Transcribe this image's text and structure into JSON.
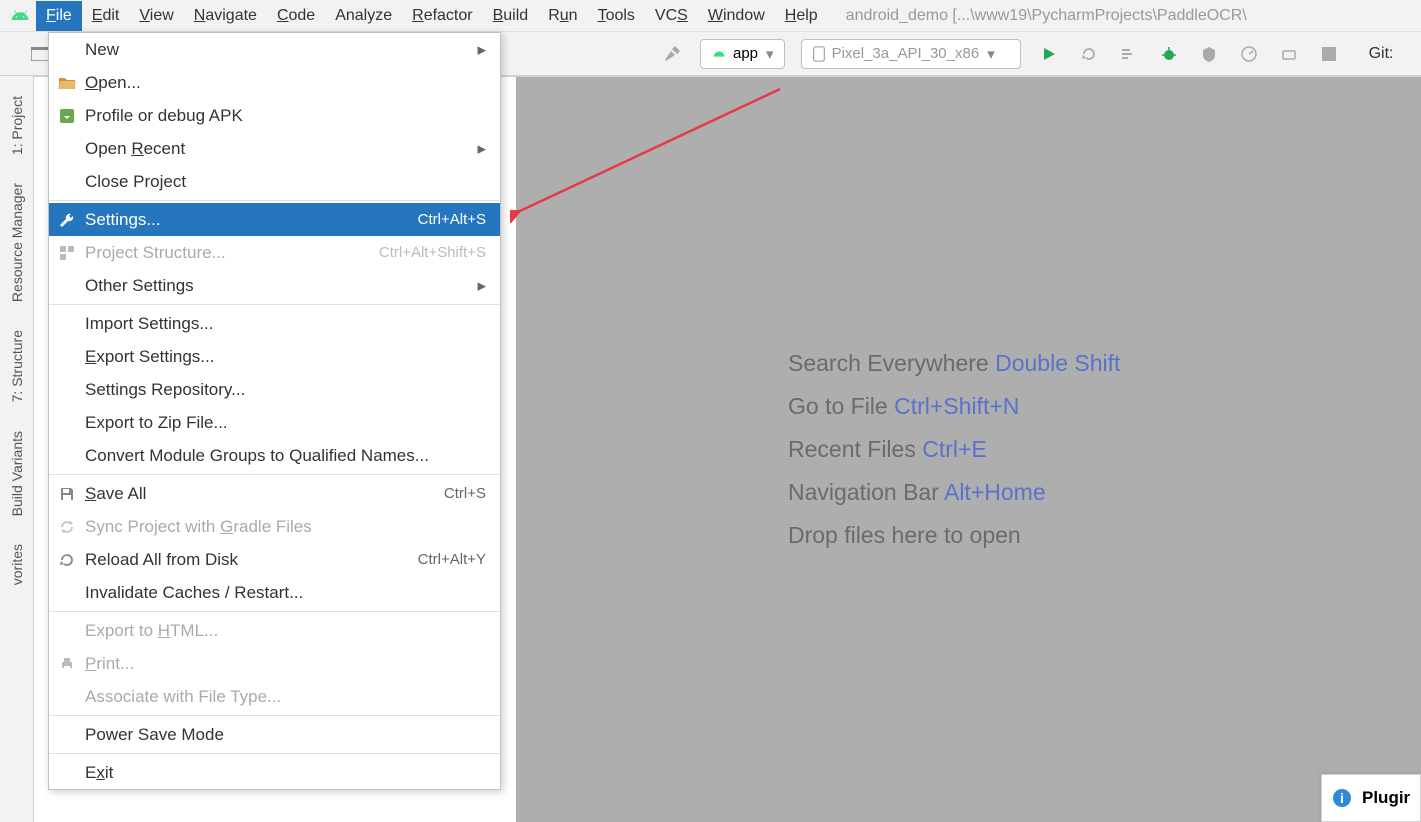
{
  "menubar": {
    "items": [
      {
        "label": "File",
        "underline": "F",
        "active": true
      },
      {
        "label": "Edit",
        "underline": "E"
      },
      {
        "label": "View",
        "underline": "V"
      },
      {
        "label": "Navigate",
        "underline": "N"
      },
      {
        "label": "Code",
        "underline": "C"
      },
      {
        "label": "Analyze"
      },
      {
        "label": "Refactor",
        "underline": "R"
      },
      {
        "label": "Build",
        "underline": "B"
      },
      {
        "label": "Run",
        "underline": "u"
      },
      {
        "label": "Tools",
        "underline": "T"
      },
      {
        "label": "VCS",
        "underline": "S"
      },
      {
        "label": "Window",
        "underline": "W"
      },
      {
        "label": "Help",
        "underline": "H"
      }
    ],
    "project_title": "android_demo [...\\www19\\PycharmProjects\\PaddleOCR\\"
  },
  "toolbar": {
    "app_selector": "app",
    "device_selector": "Pixel_3a_API_30_x86",
    "git_label": "Git:"
  },
  "tool_strip": {
    "items": [
      {
        "label": "1: Project",
        "icon": "folder-icon"
      },
      {
        "label": "Resource Manager",
        "icon": "resource-icon"
      },
      {
        "label": "7: Structure",
        "icon": "structure-icon"
      },
      {
        "label": "Build Variants",
        "icon": "variants-icon"
      },
      {
        "label": "vorites",
        "icon": "star-icon"
      }
    ]
  },
  "file_menu": {
    "groups": [
      [
        {
          "label": "New",
          "submenu": true,
          "icon": ""
        },
        {
          "label": "Open...",
          "underline": "O",
          "icon": "folder-open-icon"
        },
        {
          "label": "Profile or debug APK",
          "icon": "apk-icon"
        },
        {
          "label": "Open Recent",
          "underline": "R",
          "submenu": true
        },
        {
          "label": "Close Project"
        }
      ],
      [
        {
          "label": "Settings...",
          "shortcut": "Ctrl+Alt+S",
          "highlighted": true,
          "icon": "wrench-icon"
        },
        {
          "label": "Project Structure...",
          "shortcut": "Ctrl+Alt+Shift+S",
          "disabled": true,
          "icon": "project-structure-icon"
        },
        {
          "label": "Other Settings",
          "submenu": true
        }
      ],
      [
        {
          "label": "Import Settings..."
        },
        {
          "label": "Export Settings...",
          "underline": "E"
        },
        {
          "label": "Settings Repository..."
        },
        {
          "label": "Export to Zip File..."
        },
        {
          "label": "Convert Module Groups to Qualified Names..."
        }
      ],
      [
        {
          "label": "Save All",
          "underline": "S",
          "shortcut": "Ctrl+S",
          "icon": "save-all-icon"
        },
        {
          "label": "Sync Project with Gradle Files",
          "underline": "G",
          "disabled": true,
          "icon": "sync-icon"
        },
        {
          "label": "Reload All from Disk",
          "shortcut": "Ctrl+Alt+Y",
          "icon": "reload-icon"
        },
        {
          "label": "Invalidate Caches / Restart..."
        }
      ],
      [
        {
          "label": "Export to HTML...",
          "underline": "H",
          "disabled": true
        },
        {
          "label": "Print...",
          "underline": "P",
          "disabled": true,
          "icon": "print-icon"
        },
        {
          "label": "Associate with File Type...",
          "disabled": true
        }
      ],
      [
        {
          "label": "Power Save Mode"
        }
      ],
      [
        {
          "label": "Exit",
          "underline": "x"
        }
      ]
    ]
  },
  "editor_hints": [
    {
      "text": "Search Everywhere",
      "key": "Double Shift"
    },
    {
      "text": "Go to File",
      "key": "Ctrl+Shift+N"
    },
    {
      "text": "Recent Files",
      "key": "Ctrl+E"
    },
    {
      "text": "Navigation Bar",
      "key": "Alt+Home"
    },
    {
      "text": "Drop files here to open",
      "key": ""
    }
  ],
  "plugin_popup": {
    "label": "Plugir"
  }
}
